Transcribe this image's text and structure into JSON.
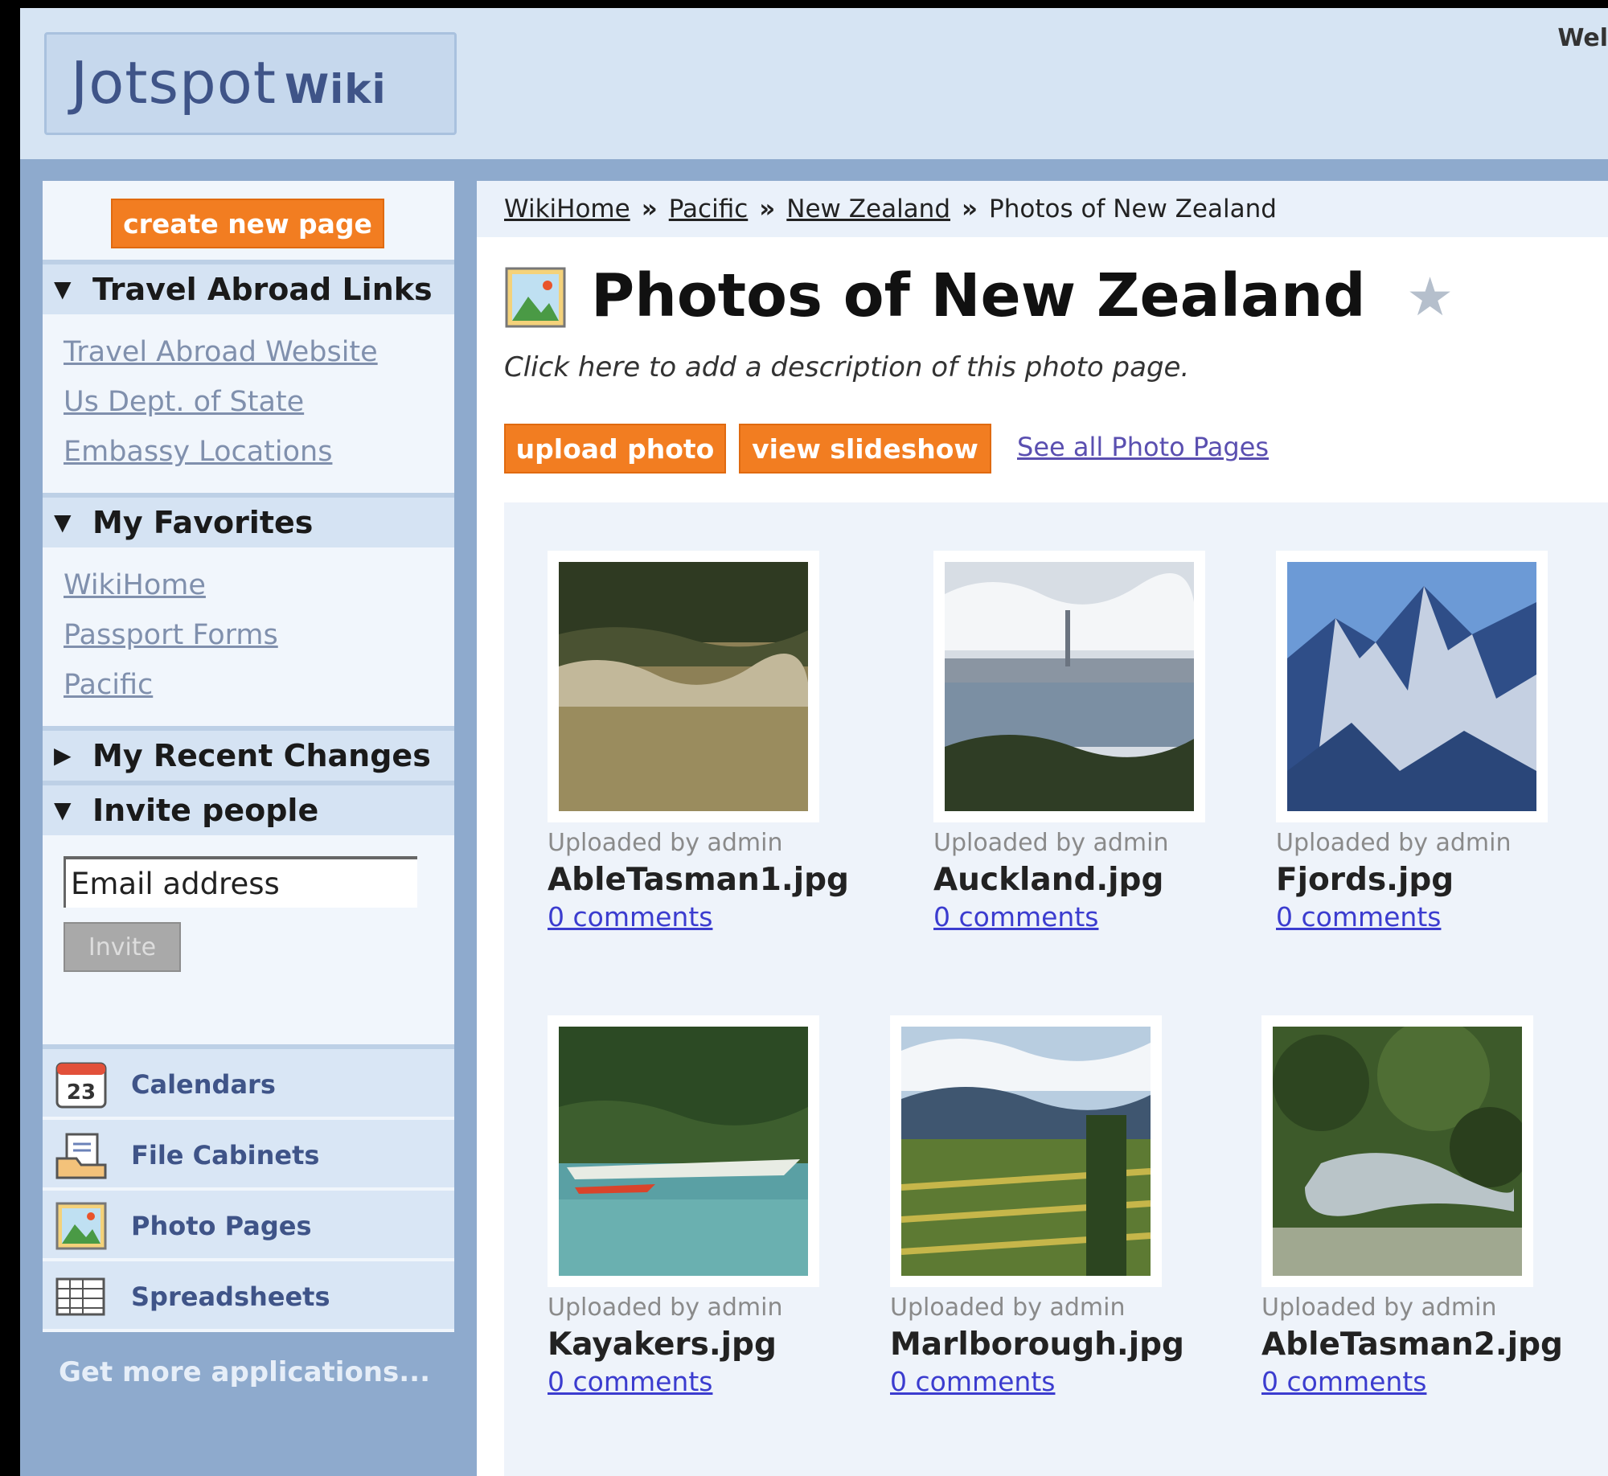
{
  "header": {
    "logo": "Jotspot",
    "logo_suffix": "Wiki",
    "welcome": "Wel"
  },
  "sidebar": {
    "create_label": "create new page",
    "travel": {
      "title": "Travel Abroad Links",
      "links": [
        "Travel Abroad Website",
        "Us Dept. of State",
        "Embassy Locations"
      ]
    },
    "favorites": {
      "title": "My Favorites",
      "links": [
        "WikiHome",
        "Passport Forms",
        "Pacific"
      ]
    },
    "recent": {
      "title": "My Recent Changes"
    },
    "invite": {
      "title": "Invite people",
      "email_value": "Email address",
      "button": "Invite"
    },
    "apps": [
      {
        "label": "Calendars",
        "icon": "calendar-icon",
        "day": "23"
      },
      {
        "label": "File Cabinets",
        "icon": "file-cabinet-icon"
      },
      {
        "label": "Photo Pages",
        "icon": "photo-page-icon"
      },
      {
        "label": "Spreadsheets",
        "icon": "spreadsheet-icon"
      }
    ],
    "get_more": "Get more applications..."
  },
  "breadcrumb": {
    "items": [
      "WikiHome",
      "Pacific",
      "New Zealand"
    ],
    "current": "Photos of New Zealand",
    "sep": "»"
  },
  "page": {
    "title": "Photos of New Zealand",
    "description": "Click here to add a description of this photo page.",
    "upload_label": "upload photo",
    "slideshow_label": "view slideshow",
    "see_all": "See all Photo Pages"
  },
  "photos": [
    {
      "uploaded": "Uploaded by admin",
      "name": "AbleTasman1.jpg",
      "comments": "0 comments"
    },
    {
      "uploaded": "Uploaded by admin",
      "name": "Auckland.jpg",
      "comments": "0 comments"
    },
    {
      "uploaded": "Uploaded by admin",
      "name": "Fjords.jpg",
      "comments": "0 comments"
    },
    {
      "uploaded": "Uploaded by admin",
      "name": "Kayakers.jpg",
      "comments": "0 comments"
    },
    {
      "uploaded": "Uploaded by admin",
      "name": "Marlborough.jpg",
      "comments": "0 comments"
    },
    {
      "uploaded": "Uploaded by admin",
      "name": "AbleTasman2.jpg",
      "comments": "0 comments"
    }
  ],
  "colors": {
    "accent": "#f27d21",
    "link": "#3b3ccf",
    "panel": "#d5e3f3",
    "frame": "#8eaacd"
  }
}
